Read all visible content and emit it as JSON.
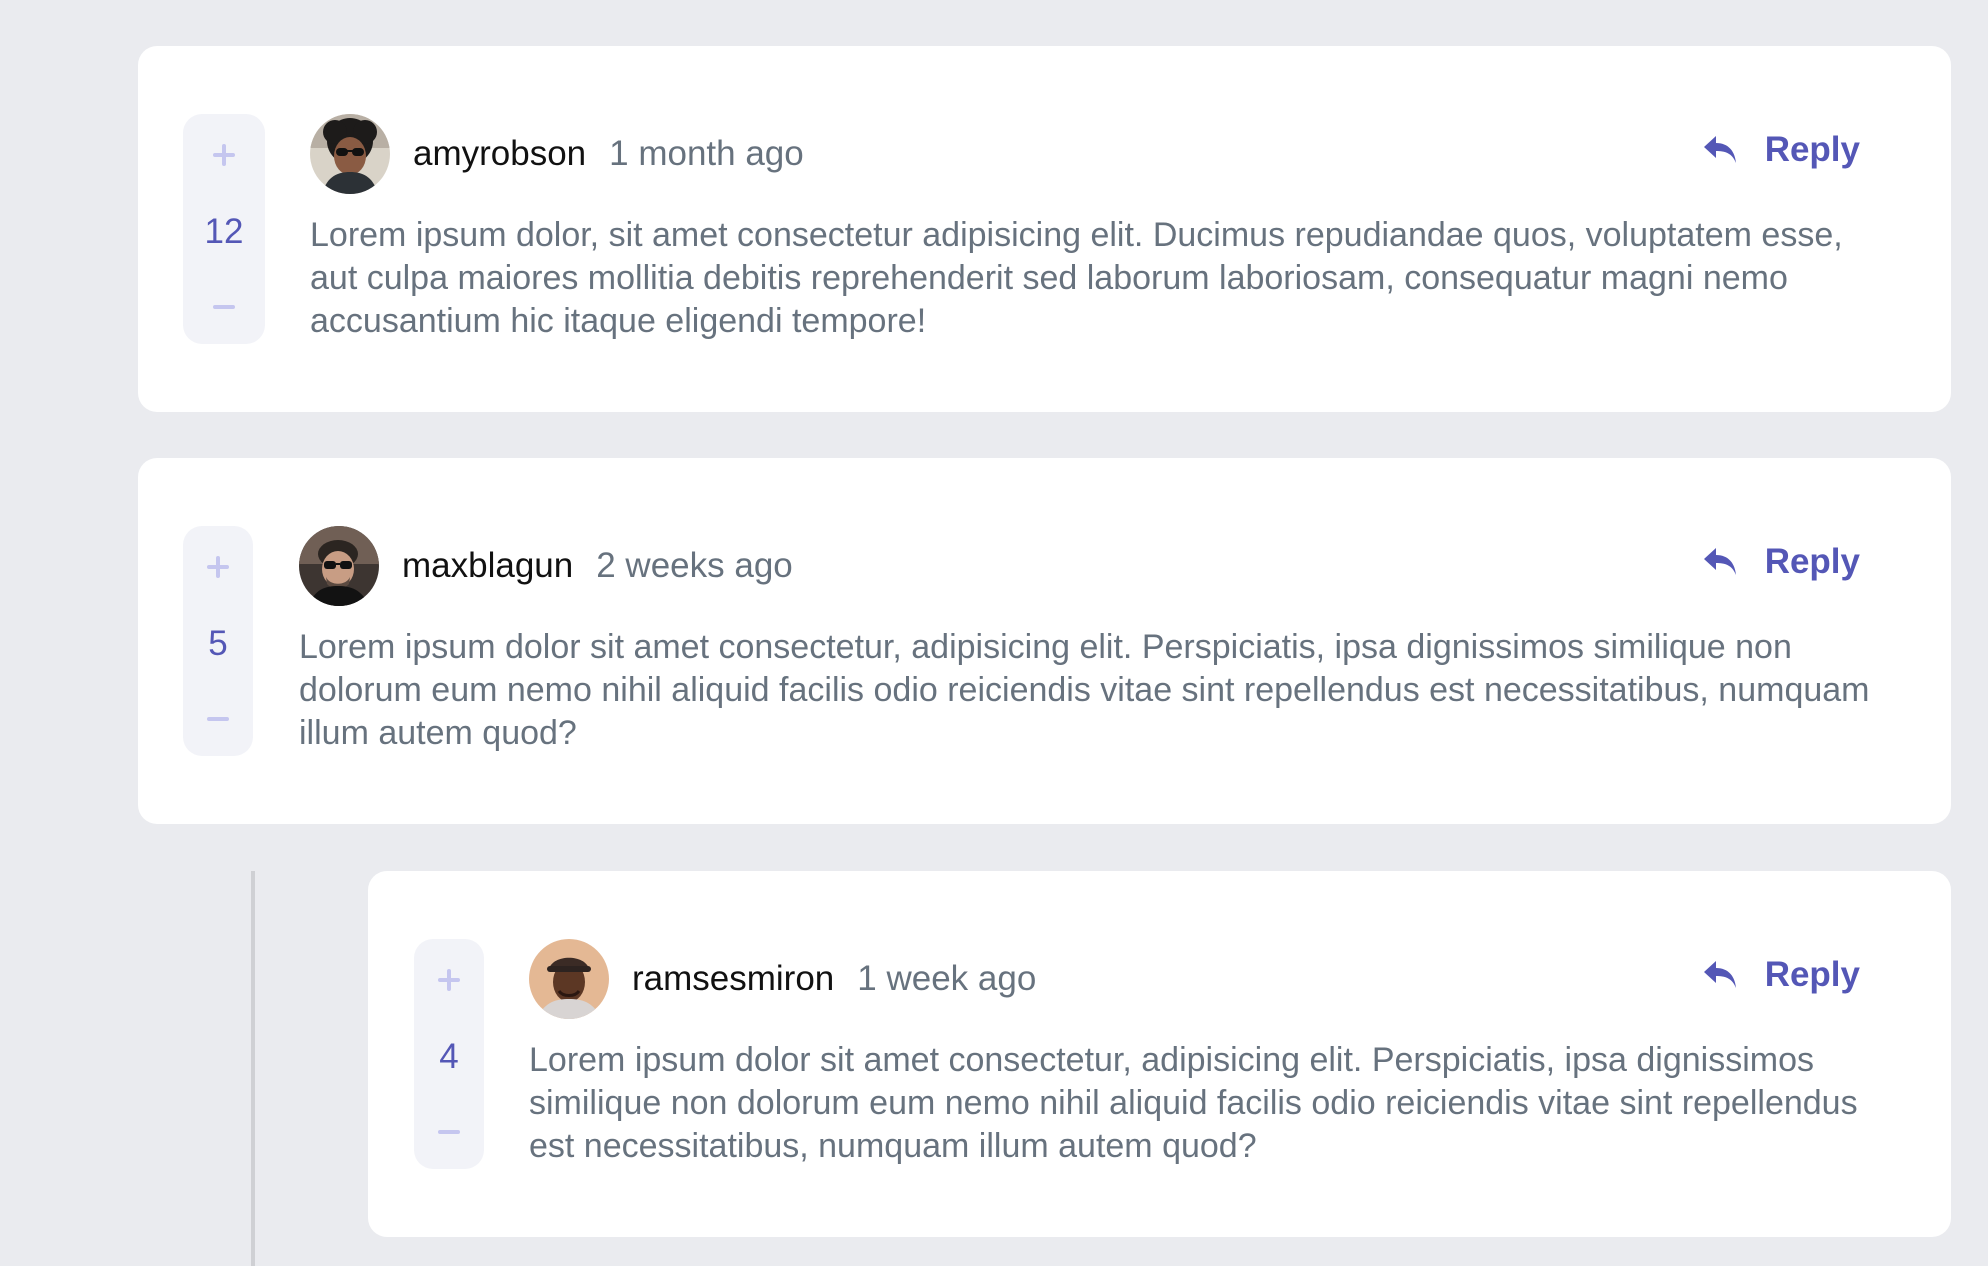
{
  "comments": [
    {
      "username": "amyrobson",
      "time": "1 month ago",
      "score": "12",
      "body": "Lorem ipsum dolor, sit amet consectetur adipisicing elit. Ducimus repudiandae quos, voluptatem esse, aut culpa maiores mollitia debitis reprehenderit sed laborum laboriosam, consequatur magni nemo accusantium hic itaque eligendi tempore!",
      "reply_label": "Reply"
    },
    {
      "username": "maxblagun",
      "time": "2 weeks ago",
      "score": "5",
      "body": "Lorem ipsum dolor sit amet consectetur, adipisicing elit. Perspiciatis, ipsa dignissimos similique non dolorum eum nemo nihil aliquid facilis odio reiciendis vitae sint repellendus est necessitatibus, numquam illum autem quod?",
      "reply_label": "Reply"
    }
  ],
  "replies": [
    {
      "username": "ramsesmiron",
      "time": "1 week ago",
      "score": "4",
      "body": "Lorem ipsum dolor sit amet consectetur, adipisicing elit. Perspiciatis, ipsa dignissimos similique non dolorum eum nemo nihil aliquid facilis odio reiciendis vitae sint repellendus est necessitatibus, numquam illum autem quod?",
      "reply_label": "Reply"
    }
  ],
  "icons": {
    "upvote": "plus-icon",
    "downvote": "minus-icon",
    "reply": "reply-arrow-icon"
  },
  "colors": {
    "background": "#eaebef",
    "card": "#ffffff",
    "accent": "#5457b6",
    "vote_icon": "#c5c6ef",
    "vote_bg": "#f2f3f8",
    "text_muted": "#67727e",
    "text_dark": "#111111",
    "thread_line": "#cfd0d4"
  }
}
